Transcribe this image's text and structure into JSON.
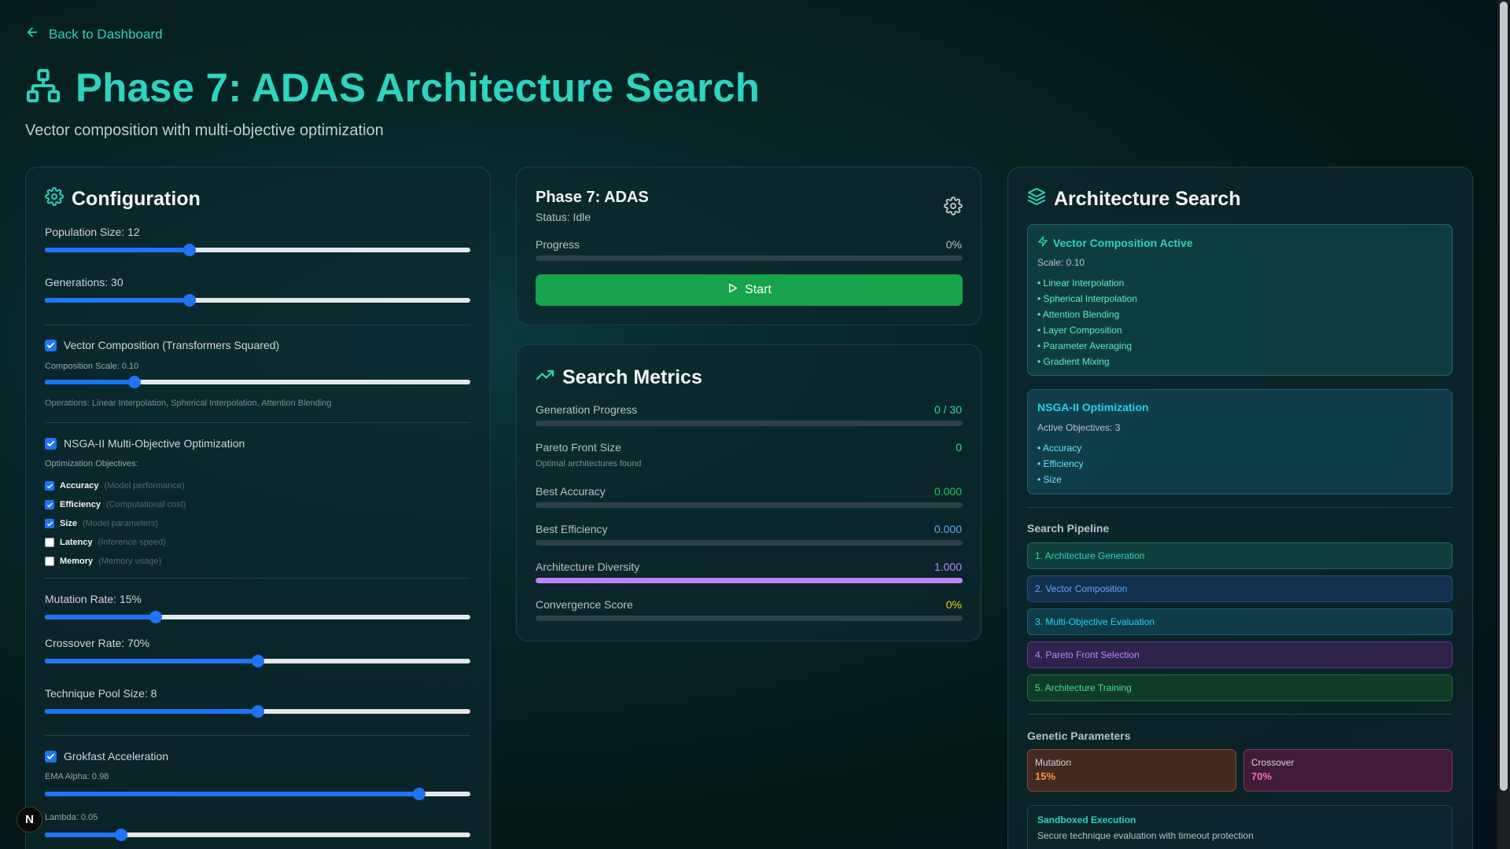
{
  "header": {
    "back_label": "Back to Dashboard",
    "title": "Phase 7: ADAS Architecture Search",
    "subtitle": "Vector composition with multi-objective optimization"
  },
  "config": {
    "title": "Configuration",
    "population_label": "Population Size: 12",
    "population_value": 0.34,
    "generations_label": "Generations: 30",
    "generations_value": 0.34,
    "vector_label": "Vector Composition (Transformers Squared)",
    "vector_checked": true,
    "composition_scale_label": "Composition Scale: 0.10",
    "composition_scale_value": 0.21,
    "operations_text": "Operations: Linear Interpolation, Spherical Interpolation, Attention Blending",
    "nsga_label": "NSGA-II Multi-Objective Optimization",
    "nsga_checked": true,
    "objectives_heading": "Optimization Objectives:",
    "objectives": [
      {
        "name": "Accuracy",
        "desc": "(Model performance)",
        "checked": true
      },
      {
        "name": "Efficiency",
        "desc": "(Computational cost)",
        "checked": true
      },
      {
        "name": "Size",
        "desc": "(Model parameters)",
        "checked": true
      },
      {
        "name": "Latency",
        "desc": "(Inference speed)",
        "checked": false
      },
      {
        "name": "Memory",
        "desc": "(Memory usage)",
        "checked": false
      }
    ],
    "mutation_label": "Mutation Rate: 15%",
    "mutation_value": 0.26,
    "crossover_label": "Crossover Rate: 70%",
    "crossover_value": 0.5,
    "technique_label": "Technique Pool Size: 8",
    "technique_value": 0.5,
    "grokfast_label": "Grokfast Acceleration",
    "grokfast_checked": true,
    "ema_label": "EMA Alpha: 0.98",
    "ema_value": 0.88,
    "lambda_label": "Lambda: 0.05",
    "lambda_value": 0.18
  },
  "phase": {
    "title": "Phase 7: ADAS",
    "status": "Status: Idle",
    "progress_label": "Progress",
    "progress_text": "0%",
    "progress_value": 0,
    "start_label": "Start"
  },
  "metrics": {
    "title": "Search Metrics",
    "generation_label": "Generation Progress",
    "generation_value": "0 / 30",
    "pareto_label": "Pareto Front Size",
    "pareto_value": "0",
    "pareto_sub": "Optimal architectures found",
    "accuracy_label": "Best Accuracy",
    "accuracy_value": "0.000",
    "efficiency_label": "Best Efficiency",
    "efficiency_value": "0.000",
    "diversity_label": "Architecture Diversity",
    "diversity_value": "1.000",
    "diversity_fill": 1.0,
    "convergence_label": "Convergence Score",
    "convergence_value": "0%"
  },
  "arch": {
    "title": "Architecture Search",
    "vector_title": "Vector Composition Active",
    "vector_scale": "Scale: 0.10",
    "vector_items": [
      "• Linear Interpolation",
      "• Spherical Interpolation",
      "• Attention Blending",
      "• Layer Composition",
      "• Parameter Averaging",
      "• Gradient Mixing"
    ],
    "nsga_title": "NSGA-II Optimization",
    "nsga_active": "Active Objectives: 3",
    "nsga_items": [
      "• Accuracy",
      "• Efficiency",
      "• Size"
    ],
    "pipeline_title": "Search Pipeline",
    "pipeline": [
      "1. Architecture Generation",
      "2. Vector Composition",
      "3. Multi-Objective Evaluation",
      "4. Pareto Front Selection",
      "5. Architecture Training"
    ],
    "genetic_title": "Genetic Parameters",
    "mutation_label": "Mutation",
    "mutation_value": "15%",
    "crossover_label": "Crossover",
    "crossover_value": "70%",
    "sandbox_title": "Sandboxed Execution",
    "sandbox_text": "Secure technique evaluation with timeout protection"
  },
  "floating": {
    "badge": "N"
  },
  "colors": {
    "accent": "#2dd4bf",
    "blue": "#1d74f5",
    "green": "#16a34a",
    "purple": "#c084fc",
    "amber": "#facc15"
  }
}
